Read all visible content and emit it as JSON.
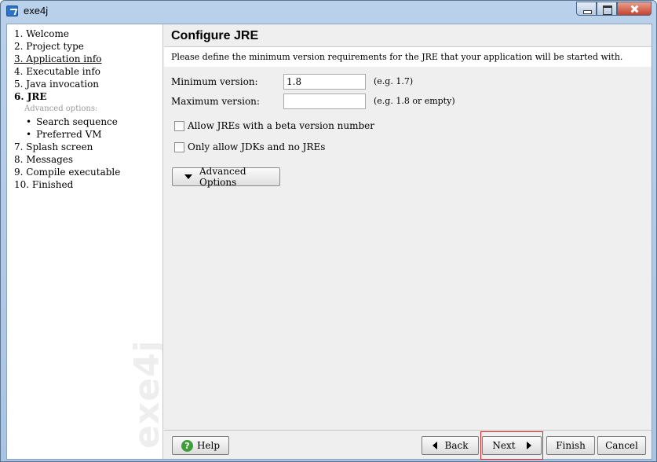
{
  "window": {
    "title": "exe4j"
  },
  "steps": {
    "items": [
      {
        "label": "1. Welcome",
        "state": "normal"
      },
      {
        "label": "2. Project type",
        "state": "normal"
      },
      {
        "label": "3. Application info",
        "state": "link"
      },
      {
        "label": "4. Executable info",
        "state": "normal"
      },
      {
        "label": "5. Java invocation",
        "state": "normal"
      },
      {
        "label": "6. JRE",
        "state": "current"
      },
      {
        "label": "Advanced options:",
        "state": "sublabel"
      },
      {
        "label": "Search sequence",
        "state": "sub"
      },
      {
        "label": "Preferred VM",
        "state": "sub"
      },
      {
        "label": "7. Splash screen",
        "state": "normal"
      },
      {
        "label": "8. Messages",
        "state": "normal"
      },
      {
        "label": "9. Compile executable",
        "state": "normal"
      },
      {
        "label": "10. Finished",
        "state": "normal"
      }
    ],
    "watermark": "exe4j"
  },
  "main": {
    "title": "Configure JRE",
    "description": "Please define the minimum version requirements for the JRE that your application will be started with.",
    "min_version": {
      "label": "Minimum version:",
      "value": "1.8",
      "hint": "(e.g. 1.7)"
    },
    "max_version": {
      "label": "Maximum version:",
      "value": "",
      "hint": "(e.g. 1.8 or empty)"
    },
    "checkboxes": {
      "beta": {
        "label": "Allow JREs with a beta version number",
        "checked": false
      },
      "jdk_only": {
        "label": "Only allow JDKs and no JREs",
        "checked": false
      }
    },
    "advanced_button": "Advanced Options"
  },
  "footer": {
    "help": "Help",
    "back": "Back",
    "next": "Next",
    "finish": "Finish",
    "cancel": "Cancel"
  },
  "colors": {
    "highlight": "#e0201a",
    "help_icon": "#3e9e3a",
    "title_icon": "#2a73c9"
  }
}
